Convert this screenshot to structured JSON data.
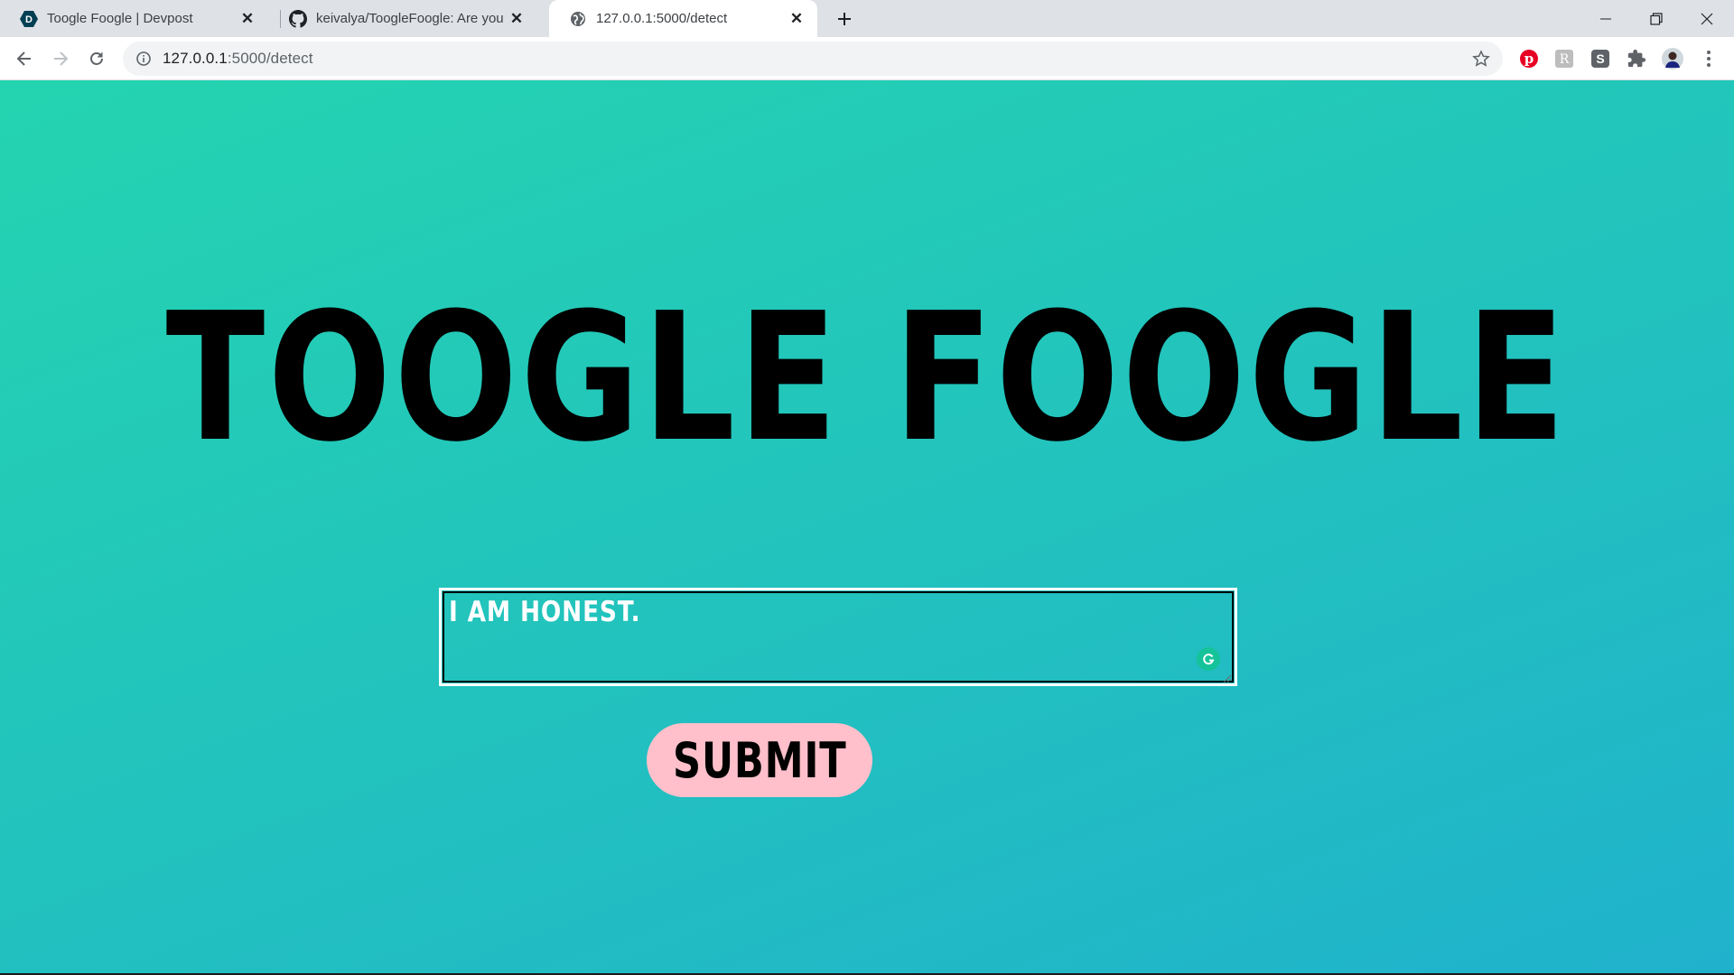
{
  "browser": {
    "tabs": [
      {
        "title": "Toogle Foogle | Devpost",
        "favicon": "devpost-icon",
        "active": false
      },
      {
        "title": "keivalya/ToogleFoogle: Are you h",
        "favicon": "github-icon",
        "active": false
      },
      {
        "title": "127.0.0.1:5000/detect",
        "favicon": "globe-icon",
        "active": true
      }
    ],
    "address": {
      "host": "127.0.0.1",
      "path": ":5000/detect"
    },
    "extensions": [
      "pinterest-icon",
      "extension-r-icon",
      "extension-s-icon",
      "puzzle-icon",
      "profile-avatar"
    ]
  },
  "page": {
    "title": "TOOGLE FOOGLE",
    "input_value": "I AM HONEST.",
    "submit_label": "SUBMIT"
  },
  "colors": {
    "gradient_start": "#24d4b0",
    "gradient_end": "#20b2cc",
    "submit_bg": "#ffc0cb",
    "title_color": "#000000"
  }
}
